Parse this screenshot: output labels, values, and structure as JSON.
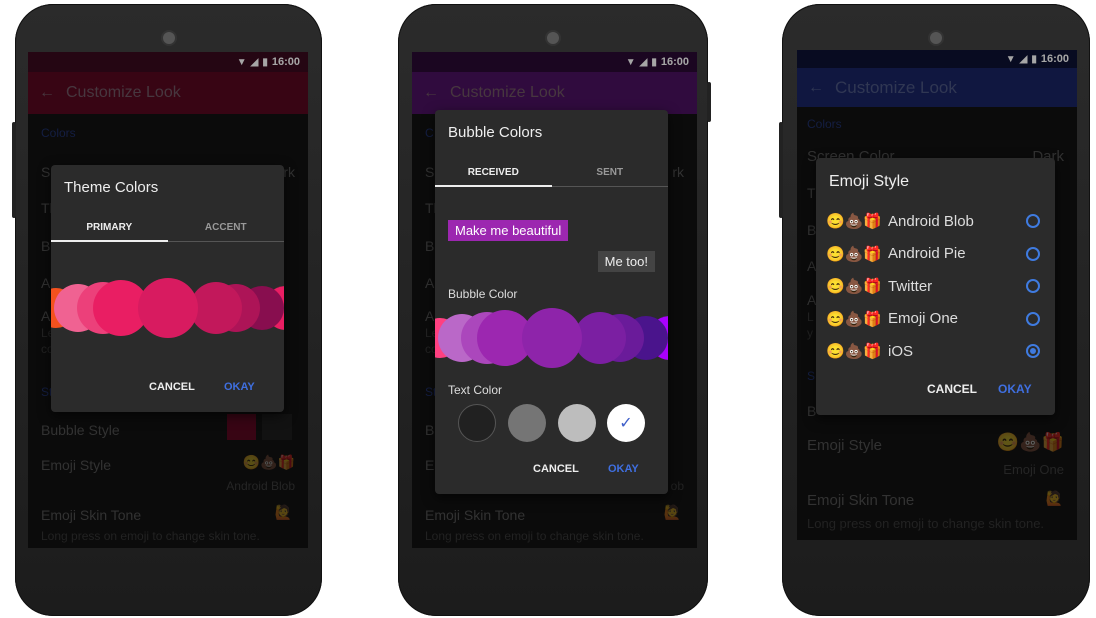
{
  "status": {
    "time": "16:00",
    "wifi_icon": "wifi-icon",
    "signal_icon": "signal-icon",
    "battery_icon": "battery-icon"
  },
  "toolbar": {
    "back_icon": "arrow-left-icon",
    "title": "Customize Look"
  },
  "phone1": {
    "colors": {
      "statusbar": "#3a0a1e",
      "toolbar": "#56091f",
      "accent": "#e91e63"
    },
    "section_colors": "Colors",
    "frag_screen": "Sc",
    "frag_screen_value": "rk",
    "frag_theme": "Th",
    "frag_bubble": "Bu",
    "frag_ap": "Ap",
    "frag_au": "Au",
    "frag_le": "Le",
    "frag_co": "co",
    "frag_st": "St",
    "bubble_style": "Bubble Style",
    "emoji_style": "Emoji Style",
    "emoji_style_icons": "😊💩🎁",
    "emoji_style_value": "Android Blob",
    "skin_tone": "Emoji Skin Tone",
    "skin_tone_icon": "🙋",
    "skin_tone_sub": "Long press on emoji to change skin tone.",
    "dialog": {
      "title": "Theme Colors",
      "tabs": [
        "PRIMARY",
        "ACCENT"
      ],
      "active_tab": 0,
      "palette": [
        "#f4511e",
        "#f06292",
        "#ec407a",
        "#e91e63",
        "#d81b60",
        "#c2185b",
        "#ad1457",
        "#880e4f",
        "#e91e63"
      ],
      "cancel": "CANCEL",
      "okay": "OKAY"
    }
  },
  "phone2": {
    "colors": {
      "statusbar": "#2a0a33",
      "toolbar": "#4a1160",
      "accent": "#9c27b0"
    },
    "frag_c": "C",
    "frag_screen": "Sc",
    "frag_screen_value": "rk",
    "frag_theme": "Th",
    "frag_bubble": "Bu",
    "frag_ap": "Ap",
    "frag_au": "Au",
    "frag_le": "Le",
    "frag_co": "co",
    "frag_st": "St",
    "frag_bu2": "Bu",
    "frag_em": "En",
    "frag_ob": "ob",
    "skin_tone": "Emoji Skin Tone",
    "skin_tone_icon": "🙋",
    "skin_tone_sub": "Long press on emoji to change skin tone.",
    "dialog": {
      "title": "Bubble Colors",
      "tabs": [
        "RECEIVED",
        "SENT"
      ],
      "active_tab": 0,
      "received_preview": "Make me beautiful",
      "sent_preview": "Me too!",
      "bubble_color_label": "Bubble Color",
      "palette": [
        "#ff4081",
        "#ba68c8",
        "#ab47bc",
        "#9c27b0",
        "#8e24aa",
        "#7b1fa2",
        "#6a1b9a",
        "#4a148c",
        "#aa00ff"
      ],
      "text_color_label": "Text Color",
      "text_colors": [
        "#212121",
        "#757575",
        "#bdbdbd",
        "#ffffff"
      ],
      "selected_text_color": 3,
      "check_icon": "check-icon",
      "cancel": "CANCEL",
      "okay": "OKAY"
    }
  },
  "phone3": {
    "colors": {
      "statusbar": "#0d1233",
      "toolbar": "#1a2463",
      "accent": "#3f7be0"
    },
    "section_colors": "Colors",
    "screen_color": "Screen Color",
    "screen_color_value": "Dark",
    "frag_t": "T",
    "frag_b": "B",
    "frag_a": "A",
    "frag_a2": "A",
    "frag_l": "L",
    "frag_y": "y",
    "frag_s": "S",
    "frag_b2": "B",
    "emoji_style": "Emoji Style",
    "emoji_style_icons": "😊💩🎁",
    "emoji_style_value": "Emoji One",
    "skin_tone": "Emoji Skin Tone",
    "skin_tone_icon": "🙋",
    "skin_tone_sub": "Long press on emoji to change skin tone.",
    "dialog": {
      "title": "Emoji Style",
      "options": [
        {
          "icons": "😊💩🎁",
          "label": "Android Blob"
        },
        {
          "icons": "😊💩🎁",
          "label": "Android Pie"
        },
        {
          "icons": "😊💩🎁",
          "label": "Twitter"
        },
        {
          "icons": "😊💩🎁",
          "label": "Emoji One"
        },
        {
          "icons": "😊💩🎁",
          "label": "iOS"
        }
      ],
      "selected_index": 4,
      "cancel": "CANCEL",
      "okay": "OKAY"
    }
  }
}
